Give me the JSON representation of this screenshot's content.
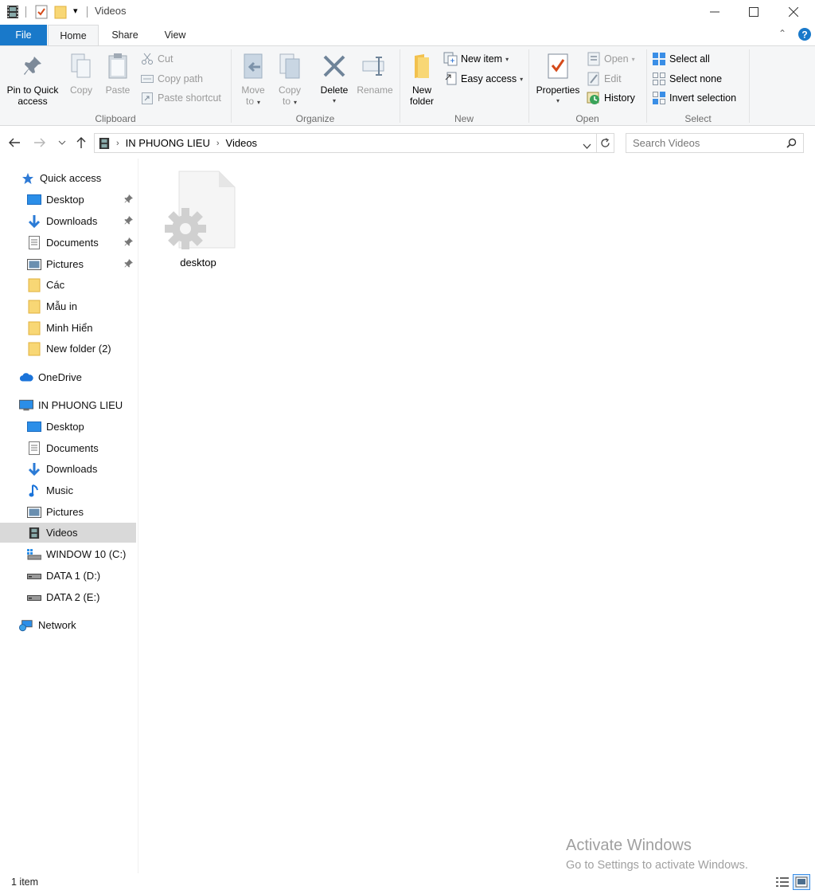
{
  "window": {
    "title": "Videos",
    "minimize": "—",
    "maximize": "☐",
    "close": "✕"
  },
  "tabs": {
    "file": "File",
    "home": "Home",
    "share": "Share",
    "view": "View"
  },
  "ribbon": {
    "clipboard": {
      "label": "Clipboard",
      "pin_line1": "Pin to Quick",
      "pin_line2": "access",
      "copy": "Copy",
      "paste": "Paste",
      "cut": "Cut",
      "copy_path": "Copy path",
      "paste_shortcut": "Paste shortcut"
    },
    "organize": {
      "label": "Organize",
      "move_line1": "Move",
      "move_line2": "to",
      "copy_line1": "Copy",
      "copy_line2": "to",
      "delete": "Delete",
      "rename": "Rename"
    },
    "new": {
      "label": "New",
      "new_folder_line1": "New",
      "new_folder_line2": "folder",
      "new_item": "New item",
      "easy_access": "Easy access"
    },
    "open": {
      "label": "Open",
      "properties": "Properties",
      "open": "Open",
      "edit": "Edit",
      "history": "History"
    },
    "select": {
      "label": "Select",
      "select_all": "Select all",
      "select_none": "Select none",
      "invert_selection": "Invert selection"
    }
  },
  "address": {
    "segments": [
      "IN PHUONG LIEU",
      "Videos"
    ],
    "search_placeholder": "Search Videos"
  },
  "sidebar": {
    "quick_access": "Quick access",
    "quick_items": [
      {
        "label": "Desktop"
      },
      {
        "label": "Downloads"
      },
      {
        "label": "Documents"
      },
      {
        "label": "Pictures"
      },
      {
        "label": "Các"
      },
      {
        "label": "Mẫu in"
      },
      {
        "label": "Minh Hiển"
      },
      {
        "label": "New folder (2)"
      }
    ],
    "onedrive": "OneDrive",
    "this_pc": "IN PHUONG LIEU",
    "pc_items": [
      {
        "label": "Desktop"
      },
      {
        "label": "Documents"
      },
      {
        "label": "Downloads"
      },
      {
        "label": "Music"
      },
      {
        "label": "Pictures"
      },
      {
        "label": "Videos"
      },
      {
        "label": "WINDOW 10 (C:)"
      },
      {
        "label": "DATA 1 (D:)"
      },
      {
        "label": "DATA 2 (E:)"
      }
    ],
    "network": "Network"
  },
  "content": {
    "files": [
      {
        "name": "desktop"
      }
    ]
  },
  "watermark": {
    "title": "Activate Windows",
    "subtitle": "Go to Settings to activate Windows."
  },
  "status": {
    "count": "1 item"
  },
  "colors": {
    "file_tab": "#1979ca",
    "ribbon_bg": "#f5f6f7",
    "selected": "#d9d9d9",
    "folder": "#f8d775",
    "accent_blue": "#1979ca"
  }
}
